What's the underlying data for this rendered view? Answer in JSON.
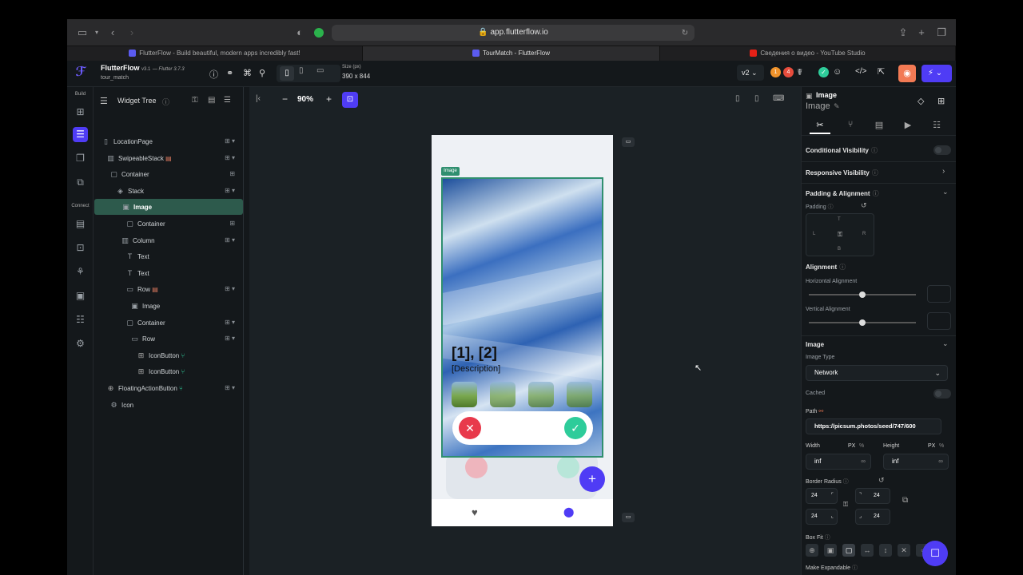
{
  "browser": {
    "url": "app.flutterflow.io",
    "tabs": [
      {
        "label": "FlutterFlow - Build beautiful, modern apps incredibly fast!",
        "color": "#5b5bf0"
      },
      {
        "label": "TourMatch - FlutterFlow",
        "color": "#5b5bf0"
      },
      {
        "label": "Сведения о видео - YouTube Studio",
        "color": "#e62117"
      }
    ]
  },
  "app": {
    "name": "FlutterFlow",
    "version": "v3.1",
    "flutter": "— Flutter 3.7.3",
    "project": "tour_match",
    "size_label": "Size (px)",
    "size_value": "390 x 844",
    "branch": "v2",
    "badge_orange": "1",
    "badge_red": "4",
    "accent": "#4f3cf5"
  },
  "rail": {
    "build_label": "Build",
    "connect_label": "Connect"
  },
  "tree": {
    "title": "Widget Tree",
    "nodes": [
      {
        "label": "LocationPage",
        "icon": "page-icon"
      },
      {
        "label": "SwipeableStack",
        "icon": "stack-icon"
      },
      {
        "label": "Container",
        "icon": "container-icon"
      },
      {
        "label": "Stack",
        "icon": "layers-icon"
      },
      {
        "label": "Image",
        "icon": "image-icon"
      },
      {
        "label": "Container",
        "icon": "container-icon"
      },
      {
        "label": "Column",
        "icon": "column-icon"
      },
      {
        "label": "Text",
        "icon": "text-icon"
      },
      {
        "label": "Text",
        "icon": "text-icon"
      },
      {
        "label": "Row",
        "icon": "row-icon"
      },
      {
        "label": "Image",
        "icon": "image-icon"
      },
      {
        "label": "Container",
        "icon": "container-icon"
      },
      {
        "label": "Row",
        "icon": "row-icon"
      },
      {
        "label": "IconButton",
        "icon": "button-icon"
      },
      {
        "label": "IconButton",
        "icon": "button-icon"
      },
      {
        "label": "FloatingActionButton",
        "icon": "fab-icon"
      },
      {
        "label": "Icon",
        "icon": "gear-icon"
      }
    ]
  },
  "canvas": {
    "zoom": "90%",
    "image_tag": "Image",
    "card_title": "[1], [2]",
    "card_desc": "[Description]",
    "fab_label": "+"
  },
  "props": {
    "header": "Image",
    "subtitle": "Image",
    "conditional_visibility": "Conditional Visibility",
    "responsive_visibility": "Responsive Visibility",
    "padding_alignment": "Padding & Alignment",
    "padding": "Padding",
    "pad_t": "T",
    "pad_l": "L",
    "pad_r": "R",
    "pad_b": "B",
    "alignment": "Alignment",
    "horizontal_alignment": "Horizontal Alignment",
    "vertical_alignment": "Vertical Alignment",
    "image_section": "Image",
    "image_type": "Image Type",
    "image_type_value": "Network",
    "cached": "Cached",
    "path": "Path",
    "path_value": "https://picsum.photos/seed/747/600",
    "width": "Width",
    "height": "Height",
    "px": "PX",
    "pct": "%",
    "width_value": "inf",
    "height_value": "inf",
    "border_radius": "Border Radius",
    "radius_values": [
      "24",
      "24",
      "24",
      "24"
    ],
    "box_fit": "Box Fit",
    "make_expandable": "Make Expandable"
  }
}
